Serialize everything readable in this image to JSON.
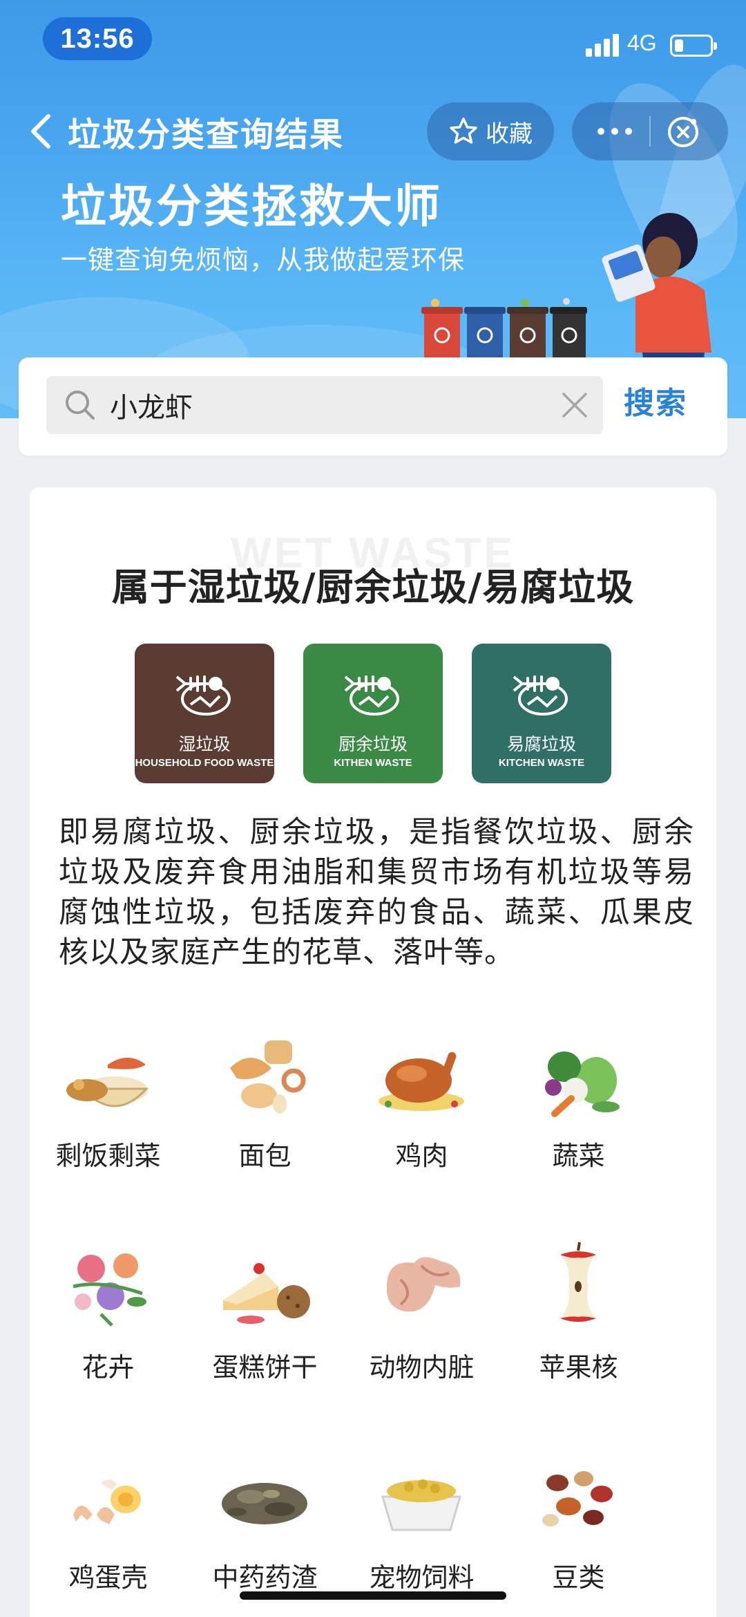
{
  "status_bar": {
    "time": "13:56",
    "network": "4G"
  },
  "nav": {
    "title": "垃圾分类查询结果",
    "favorite_label": "收藏"
  },
  "hero": {
    "title": "垃圾分类拯救大师",
    "subtitle": "一键查询免烦恼，从我做起爱环保"
  },
  "search": {
    "value": "小龙虾",
    "button_label": "搜索"
  },
  "result": {
    "watermark": "WET WASTE",
    "category_title": "属于湿垃圾/厨余垃圾/易腐垃圾",
    "badges": [
      {
        "cn": "湿垃圾",
        "en": "HOUSEHOLD FOOD WASTE",
        "color": "#5a3c32"
      },
      {
        "cn": "厨余垃圾",
        "en": "KITHEN WASTE",
        "color": "#3a8a46"
      },
      {
        "cn": "易腐垃圾",
        "en": "KITCHEN WASTE",
        "color": "#2f6f66"
      }
    ],
    "description": "即易腐垃圾、厨余垃圾，是指餐饮垃圾、厨余垃圾及废弃食用油脂和集贸市场有机垃圾等易腐蚀性垃圾，包括废弃的食品、蔬菜、瓜果皮核以及家庭产生的花草、落叶等。",
    "items": [
      {
        "label": "剩饭剩菜",
        "icon": "leftovers-icon"
      },
      {
        "label": "面包",
        "icon": "bread-icon"
      },
      {
        "label": "鸡肉",
        "icon": "chicken-icon"
      },
      {
        "label": "蔬菜",
        "icon": "vegetables-icon"
      },
      {
        "label": "花卉",
        "icon": "flowers-icon"
      },
      {
        "label": "蛋糕饼干",
        "icon": "cake-cookie-icon"
      },
      {
        "label": "动物内脏",
        "icon": "animal-organs-icon"
      },
      {
        "label": "苹果核",
        "icon": "apple-core-icon"
      },
      {
        "label": "鸡蛋壳",
        "icon": "eggshell-icon"
      },
      {
        "label": "中药药渣",
        "icon": "herb-residue-icon"
      },
      {
        "label": "宠物饲料",
        "icon": "pet-food-icon"
      },
      {
        "label": "豆类",
        "icon": "beans-icon"
      }
    ]
  },
  "colors": {
    "accent": "#2a82d8",
    "header_top": "#3d9ae8",
    "page_bg": "#eef0f4"
  }
}
